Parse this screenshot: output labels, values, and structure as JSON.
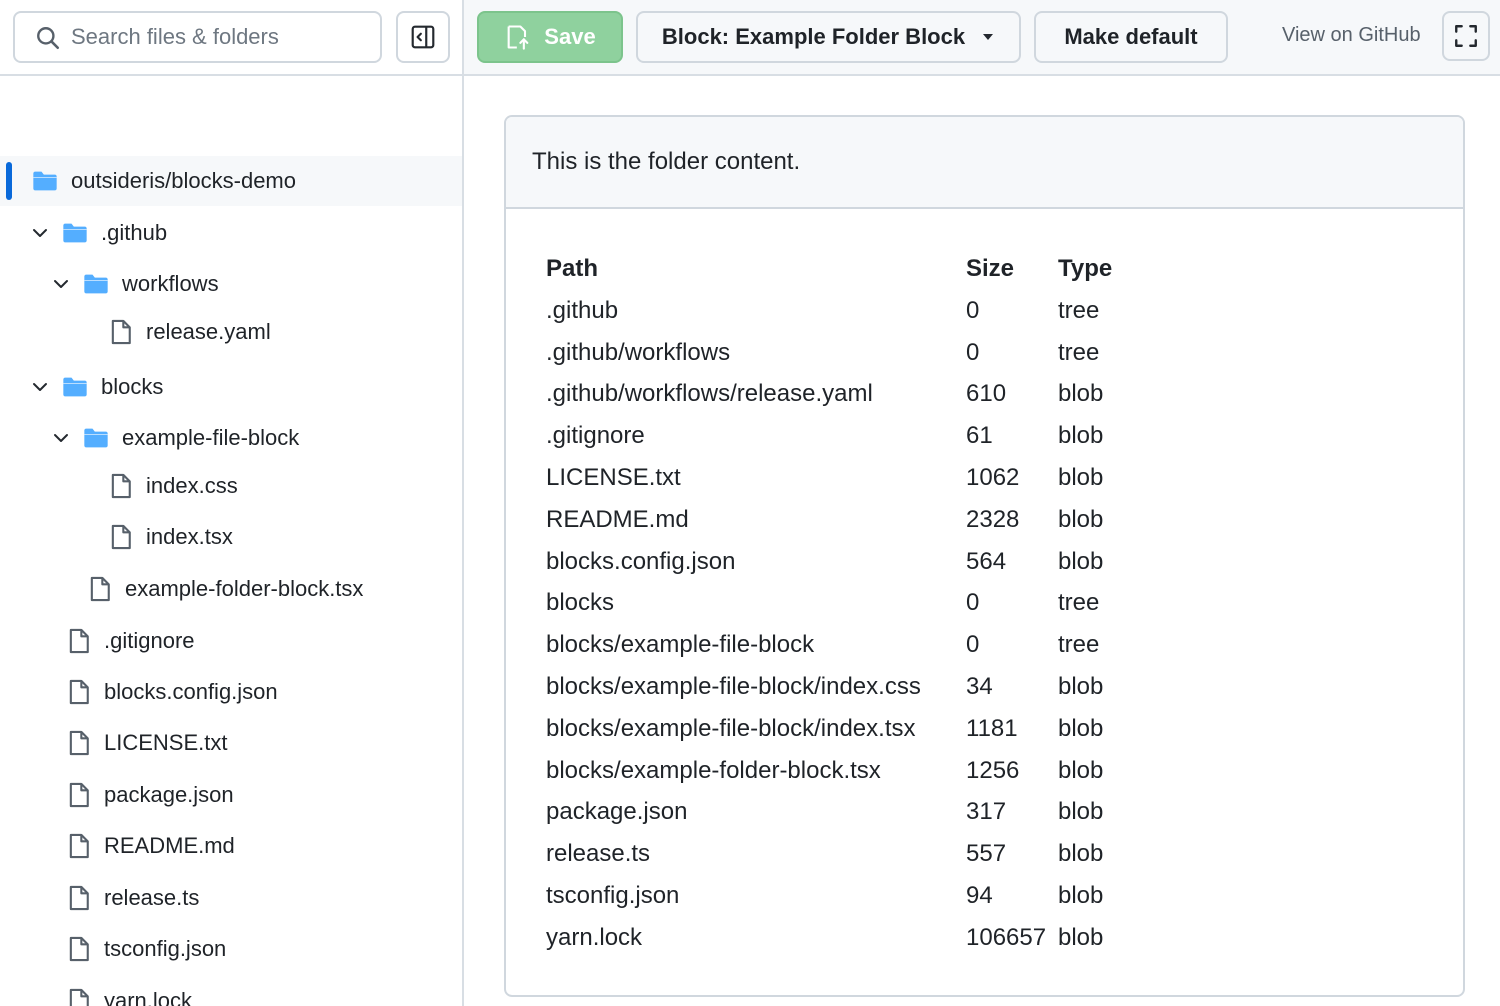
{
  "search": {
    "placeholder": "Search files & folders"
  },
  "sidebar": {
    "tree": [
      {
        "label": "outsideris/blocks-demo",
        "kind": "folder",
        "expanded": null,
        "selected": true
      },
      {
        "label": ".github",
        "kind": "folder",
        "expanded": true
      },
      {
        "label": "workflows",
        "kind": "folder",
        "expanded": true
      },
      {
        "label": "release.yaml",
        "kind": "file"
      },
      {
        "label": "blocks",
        "kind": "folder",
        "expanded": true
      },
      {
        "label": "example-file-block",
        "kind": "folder",
        "expanded": true
      },
      {
        "label": "index.css",
        "kind": "file"
      },
      {
        "label": "index.tsx",
        "kind": "file"
      },
      {
        "label": "example-folder-block.tsx",
        "kind": "file"
      },
      {
        "label": ".gitignore",
        "kind": "file"
      },
      {
        "label": "blocks.config.json",
        "kind": "file"
      },
      {
        "label": "LICENSE.txt",
        "kind": "file"
      },
      {
        "label": "package.json",
        "kind": "file"
      },
      {
        "label": "README.md",
        "kind": "file"
      },
      {
        "label": "release.ts",
        "kind": "file"
      },
      {
        "label": "tsconfig.json",
        "kind": "file"
      },
      {
        "label": "yarn.lock",
        "kind": "file"
      }
    ]
  },
  "toolbar": {
    "save_label": "Save",
    "block_select_label": "Block: Example Folder Block",
    "make_default_label": "Make default",
    "github_link_label": "View on GitHub"
  },
  "content": {
    "heading": "This is the folder content.",
    "table": {
      "headers": [
        "Path",
        "Size",
        "Type"
      ],
      "rows": [
        [
          ".github",
          "0",
          "tree"
        ],
        [
          ".github/workflows",
          "0",
          "tree"
        ],
        [
          ".github/workflows/release.yaml",
          "610",
          "blob"
        ],
        [
          ".gitignore",
          "61",
          "blob"
        ],
        [
          "LICENSE.txt",
          "1062",
          "blob"
        ],
        [
          "README.md",
          "2328",
          "blob"
        ],
        [
          "blocks.config.json",
          "564",
          "blob"
        ],
        [
          "blocks",
          "0",
          "tree"
        ],
        [
          "blocks/example-file-block",
          "0",
          "tree"
        ],
        [
          "blocks/example-file-block/index.css",
          "34",
          "blob"
        ],
        [
          "blocks/example-file-block/index.tsx",
          "1181",
          "blob"
        ],
        [
          "blocks/example-folder-block.tsx",
          "1256",
          "blob"
        ],
        [
          "package.json",
          "317",
          "blob"
        ],
        [
          "release.ts",
          "557",
          "blob"
        ],
        [
          "tsconfig.json",
          "94",
          "blob"
        ],
        [
          "yarn.lock",
          "106657",
          "blob"
        ]
      ]
    }
  },
  "colors": {
    "accent": "#0969da",
    "folder": "#54aeff",
    "save_button": "#8fd19e",
    "border": "#d0d7de"
  },
  "icons": {
    "search": "search-icon",
    "sidebar_toggle": "sidebar-collapse-icon",
    "save": "save-icon",
    "dropdown": "caret-down-icon",
    "fullscreen": "fullscreen-icon",
    "folder": "folder-icon",
    "file": "file-icon",
    "chevron": "chevron-down-icon"
  }
}
